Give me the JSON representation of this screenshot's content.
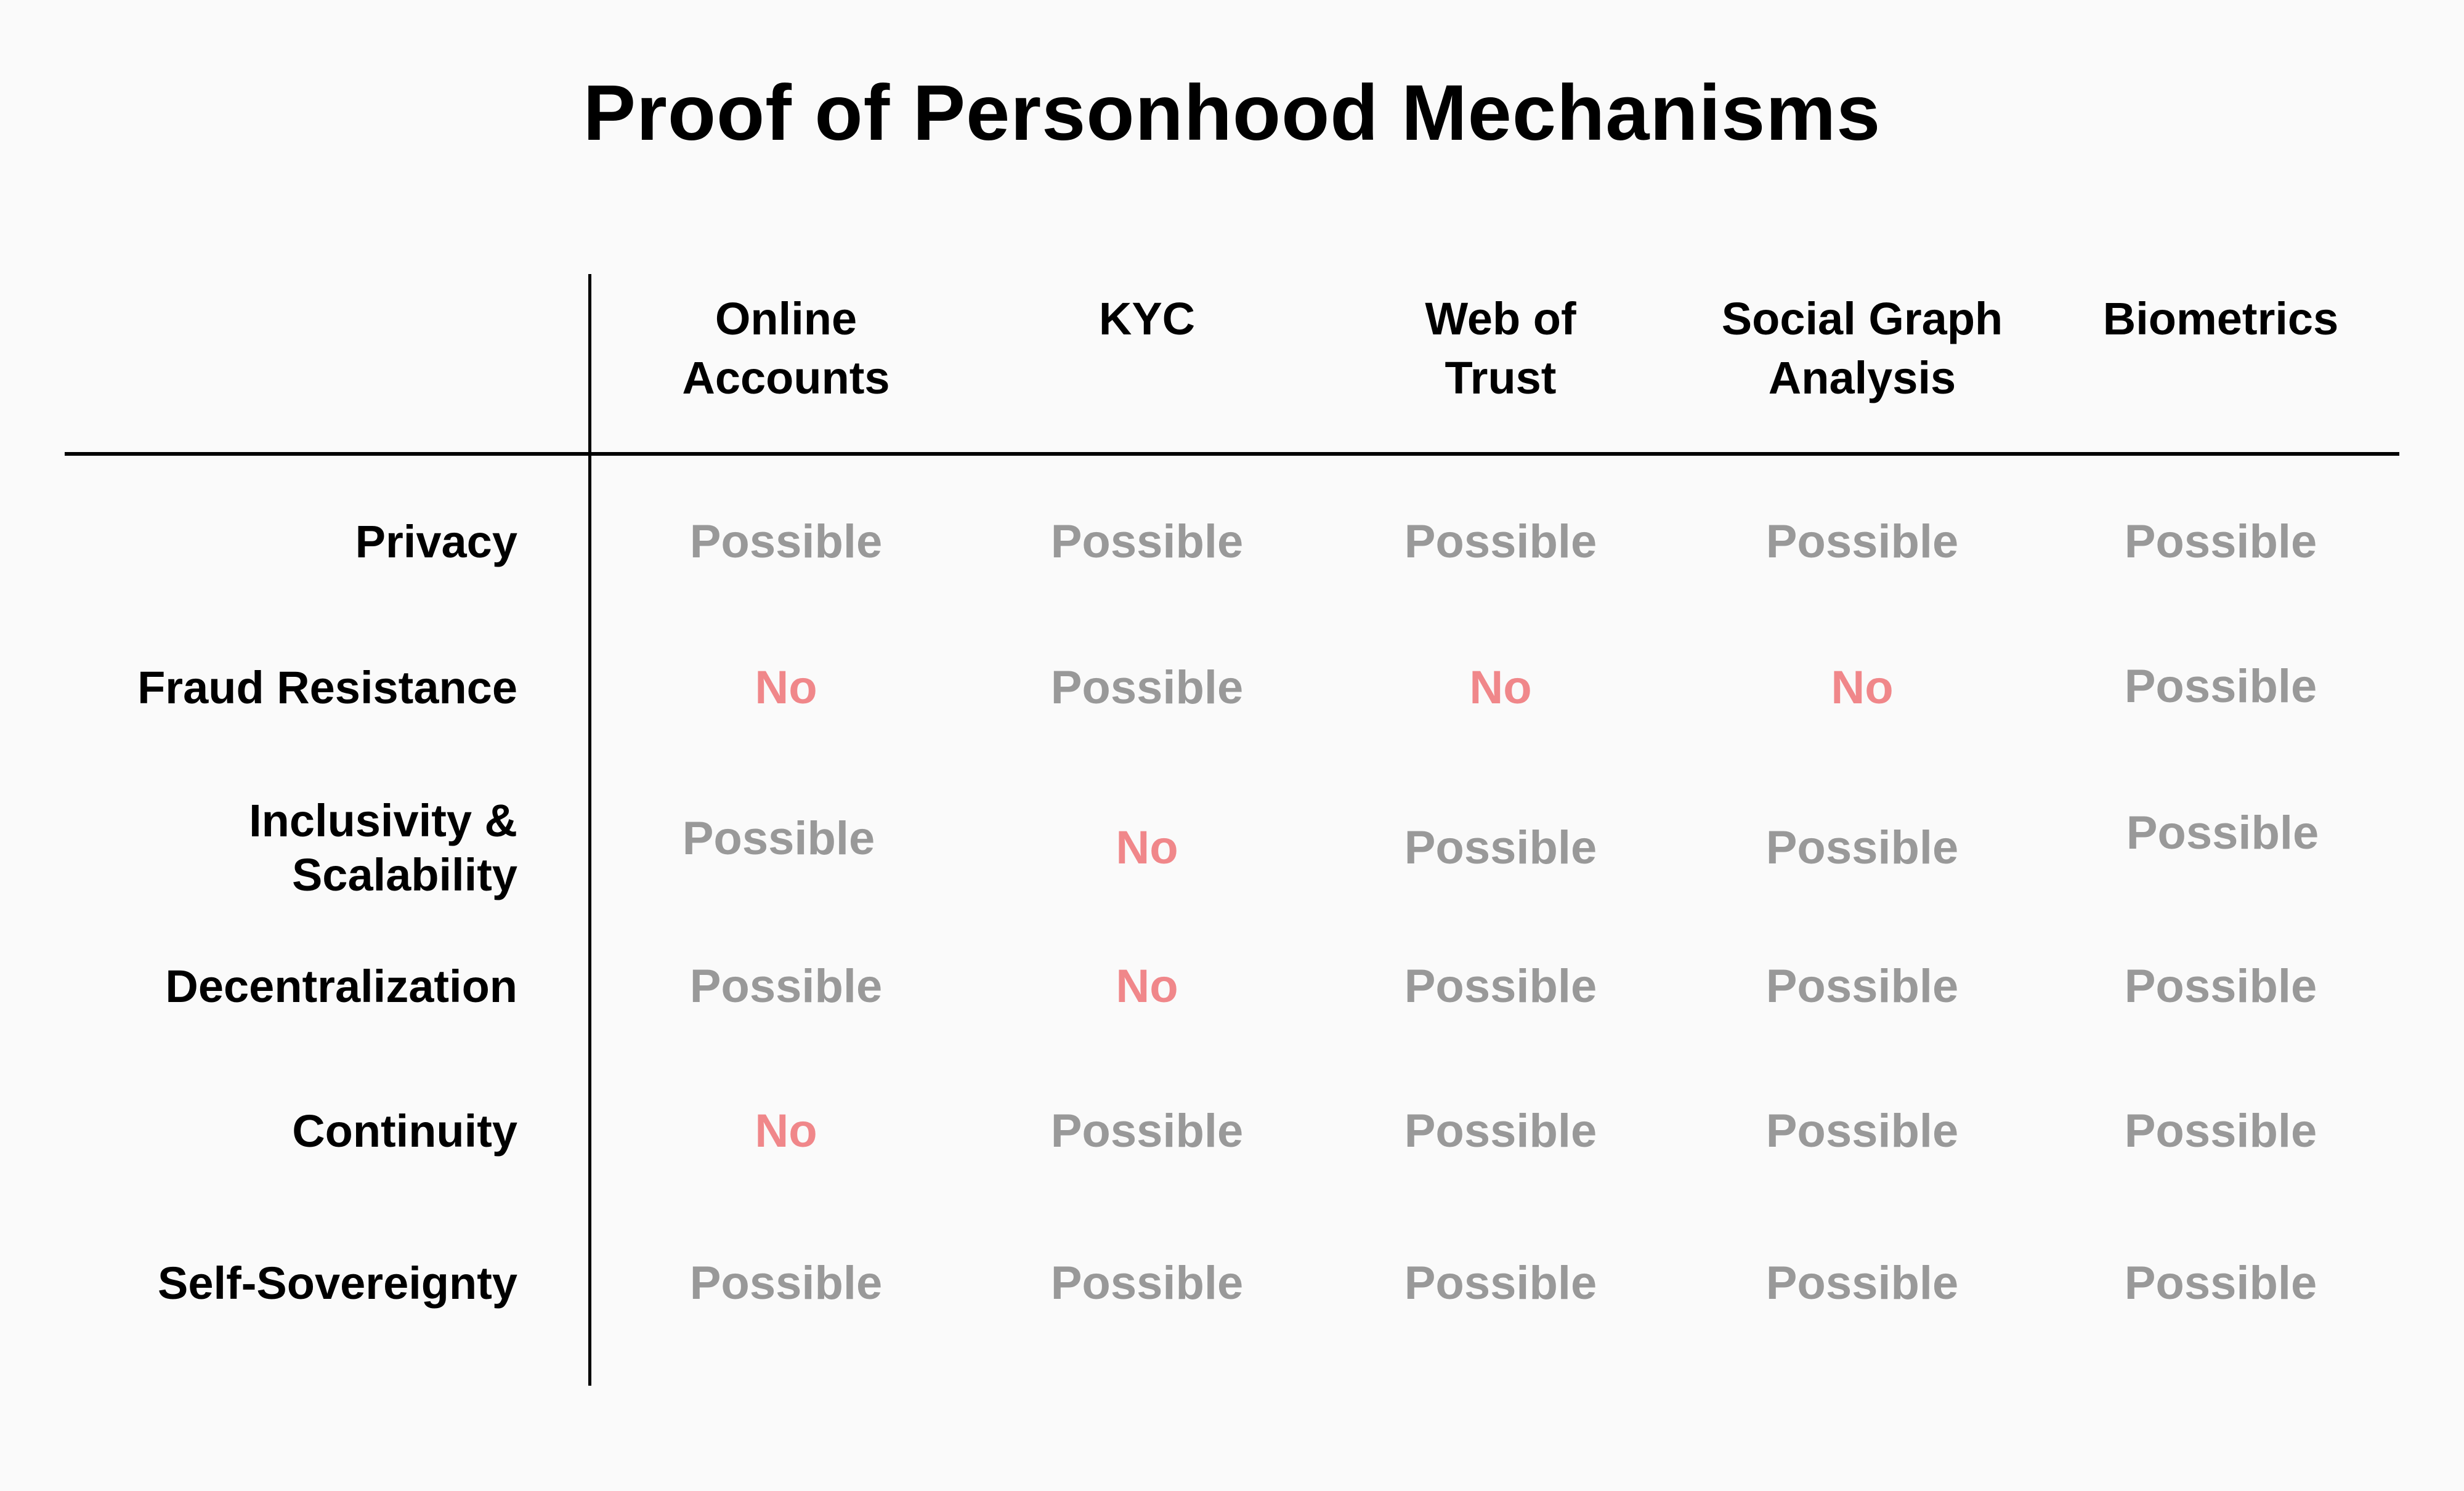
{
  "title": "Proof of Personhood Mechanisms",
  "columns": [
    {
      "line1": "Online",
      "line2": "Accounts"
    },
    {
      "line1": "KYC",
      "line2": ""
    },
    {
      "line1": "Web of",
      "line2": "Trust"
    },
    {
      "line1": "Social Graph",
      "line2": "Analysis"
    },
    {
      "line1": "Biometrics",
      "line2": ""
    }
  ],
  "rows": [
    {
      "line1": "Privacy",
      "line2": "",
      "values": [
        "Possible",
        "Possible",
        "Possible",
        "Possible",
        "Possible"
      ]
    },
    {
      "line1": "Fraud Resistance",
      "line2": "",
      "values": [
        "No",
        "Possible",
        "No",
        "No",
        "Possible"
      ]
    },
    {
      "line1": "Inclusivity &",
      "line2": "Scalability",
      "values": [
        "Possible",
        "No",
        "Possible",
        "Possible",
        "Possible"
      ]
    },
    {
      "line1": "Decentralization",
      "line2": "",
      "values": [
        "Possible",
        "No",
        "Possible",
        "Possible",
        "Possible"
      ]
    },
    {
      "line1": "Continuity",
      "line2": "",
      "values": [
        "No",
        "Possible",
        "Possible",
        "Possible",
        "Possible"
      ]
    },
    {
      "line1": "Self-Sovereignty",
      "line2": "",
      "values": [
        "Possible",
        "Possible",
        "Possible",
        "Possible",
        "Possible"
      ]
    }
  ],
  "colors": {
    "possible": "#999999",
    "no": "#f0878a",
    "text": "#000000",
    "background": "#fafafa"
  }
}
